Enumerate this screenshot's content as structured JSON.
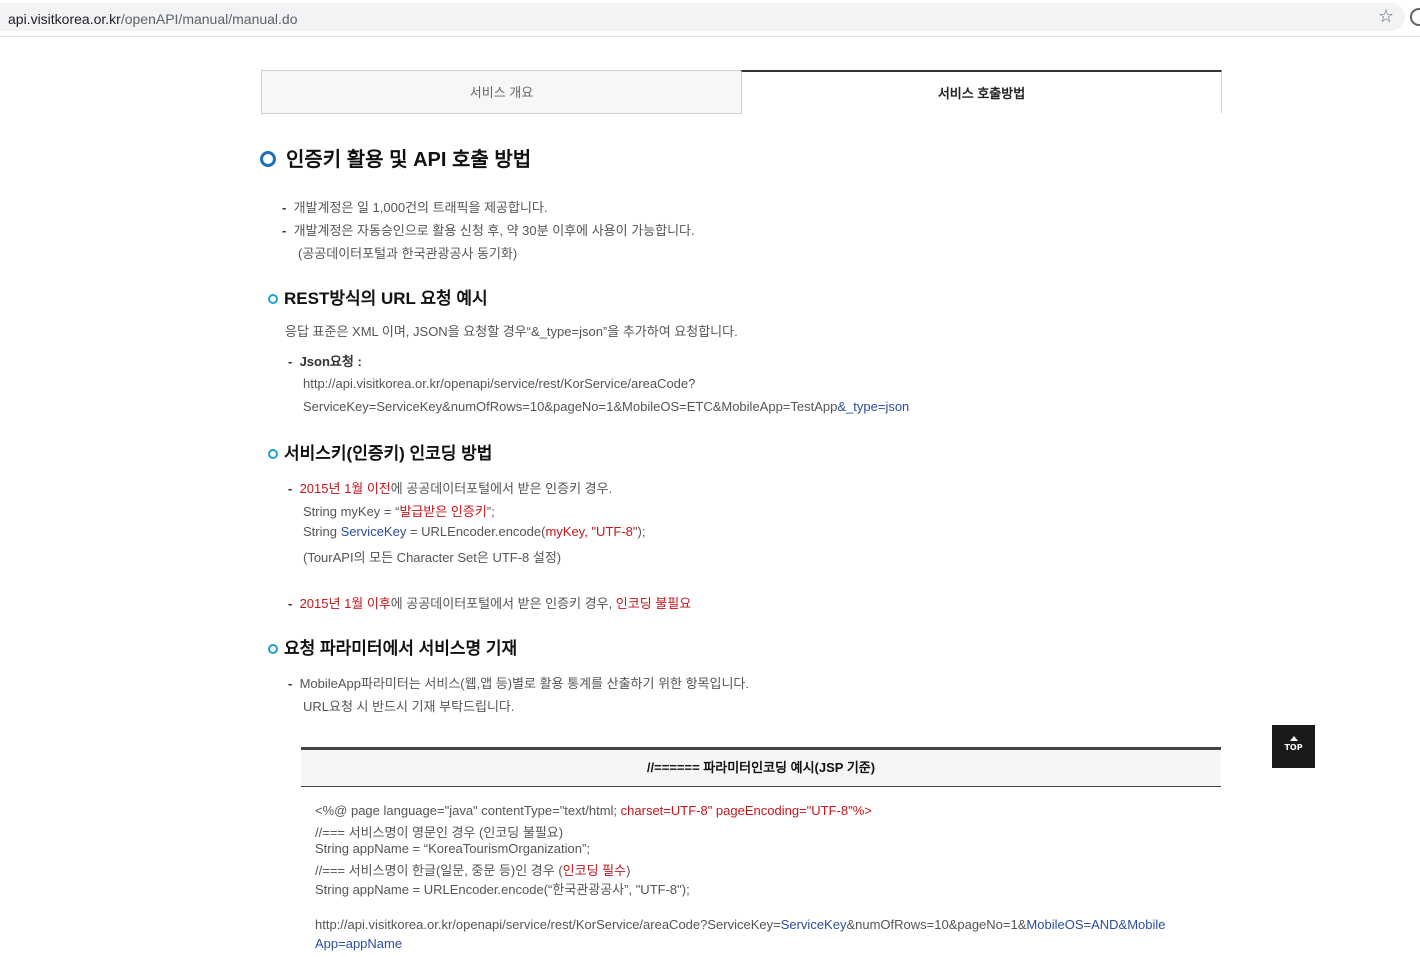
{
  "browser": {
    "url_host": "api.visitkorea.or.kr",
    "url_path": "/openAPI/manual/manual.do"
  },
  "tabs": [
    {
      "label": "서비스 개요",
      "active": false
    },
    {
      "label": "서비스 호출방법",
      "active": true
    }
  ],
  "heading": "인증키 활용 및 API 호출 방법",
  "intro": {
    "line1": "개발계정은 일 1,000건의 트래픽을 제공합니다.",
    "line2": "개발계정은 자동승인으로 활용 신청 후, 약 30분 이후에 사용이 가능합니다.",
    "line3": "(공공데이터포털과 한국관광공사 동기화)"
  },
  "rest": {
    "title": "REST방식의 URL 요청 예시",
    "desc": "응답 표준은 XML 이며, JSON을 요청할 경우“&_type=json”을 추가하여 요청합니다.",
    "json_label": "Json요청 :",
    "url1": "http://api.visitkorea.or.kr/openapi/service/rest/KorService/areaCode?",
    "url2a": "ServiceKey=ServiceKey&numOfRows=10&pageNo=1&MobileOS=ETC&MobileApp=TestApp",
    "url2b": "&_type=json"
  },
  "encoding": {
    "title": "서비스키(인증키) 인코딩 방법",
    "b1_red": "2015년 1월 이전",
    "b1_rest": "에 공공데이터포털에서 받은 인증키 경우.",
    "s1a": "String myKey = “",
    "s1b": "발급받은 인증키",
    "s1c": "”;",
    "s2a": "String ",
    "s2b": "ServiceKey",
    "s2c": " = URLEncoder.encode(",
    "s2d": "myKey, \"UTF-8\"",
    "s2e": ");",
    "s3": "(TourAPI의 모든 Character Set은 UTF-8 설정)",
    "b2_red": "2015년 1월 이후",
    "b2_rest": "에 공공데이터포털에서 받은 인증키 경우, ",
    "b2_red2": "인코딩 불필요"
  },
  "param": {
    "title": "요청 파라미터에서 서비스명 기재",
    "line1": "MobileApp파라미터는 서비스(웹,앱 등)별로 활용 통계를 산출하기 위한 항목입니다.",
    "line2": "URL요청 시 반드시 기재 부탁드립니다."
  },
  "codebox": {
    "header": "//====== 파라미터인코딩 예시(JSP 기준)",
    "c1a": "<%@ page language=\"java\" contentType=\"text/html; ",
    "c1b": "charset=UTF-8\" pageEncoding=\"UTF-8\"%>",
    "c2": "//=== 서비스명이 영문인 경우 (인코딩 불필요)",
    "c3": "String appName = “KoreaTourismOrganization”;",
    "c4a": "//=== 서비스명이 한글(일문, 중문 등)인 경우 (",
    "c4b": "인코딩 필수",
    "c4c": ")",
    "c5": "String appName = URLEncoder.encode(“한국관광공사”, \"UTF-8\");",
    "c6a": "http://api.visitkorea.or.kr/openapi/service/rest/KorService/areaCode?ServiceKey=",
    "c6b": "ServiceKey",
    "c6c": "&numOfRows=10&pageNo=1&",
    "c6d": "MobileOS=AND&Mobile",
    "c7": "App=appName"
  },
  "top_button": "TOP"
}
